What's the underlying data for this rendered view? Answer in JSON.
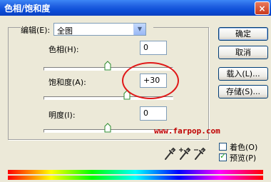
{
  "window": {
    "title": "色相/饱和度",
    "close_glyph": "×"
  },
  "edit": {
    "label": "编辑(E):",
    "value": "全图"
  },
  "hue": {
    "label": "色相(H):",
    "value": "0",
    "slider": 0.5
  },
  "saturation": {
    "label": "饱和度(A):",
    "value": "+30",
    "slider": 0.65
  },
  "lightness": {
    "label": "明度(I):",
    "value": "0",
    "slider": 0.5
  },
  "buttons": {
    "ok": "确定",
    "cancel": "取消",
    "load": "载入(L)...",
    "save": "存储(S)..."
  },
  "options": {
    "colorize_label": "着色(O)",
    "colorize": false,
    "preview_label": "预览(P)",
    "preview": true,
    "preview_check": "✓"
  },
  "watermark": "www.farpop.com",
  "colors": {
    "annotation": "#e01818",
    "watermark": "#c00000",
    "titlebar": "#0a4bd6"
  },
  "eyedroppers": [
    "eyedropper-icon",
    "eyedropper-plus-icon",
    "eyedropper-minus-icon"
  ]
}
